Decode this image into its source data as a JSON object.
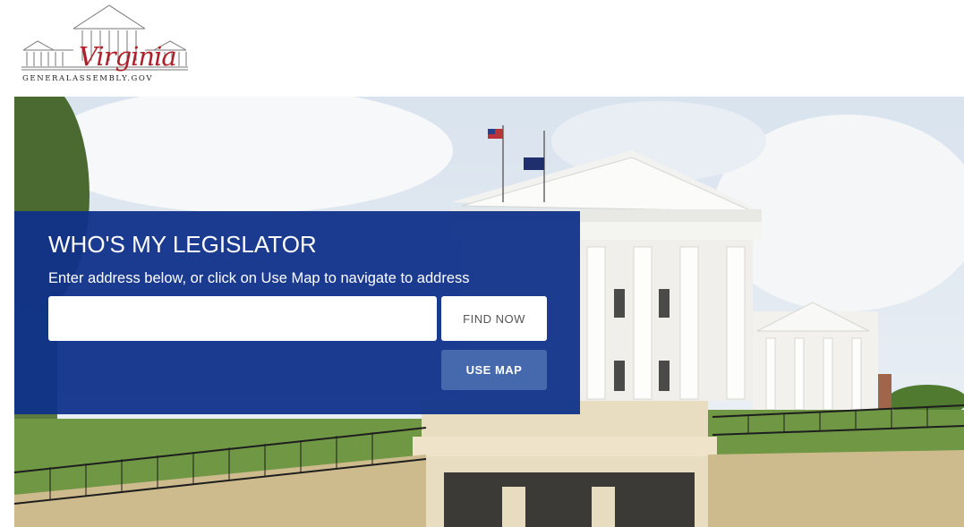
{
  "logo": {
    "script_text": "Virginia",
    "subtitle": "GENERALASSEMBLY.GOV"
  },
  "widget": {
    "title": "WHO'S MY LEGISLATOR",
    "subtitle": "Enter address below, or click on Use Map to navigate to address",
    "address_value": "",
    "address_placeholder": "",
    "find_label": "FIND NOW",
    "map_label": "USE MAP"
  },
  "colors": {
    "panel_blue": "#10318a",
    "use_map_button": "#4669ae",
    "logo_red": "#b0202a"
  }
}
